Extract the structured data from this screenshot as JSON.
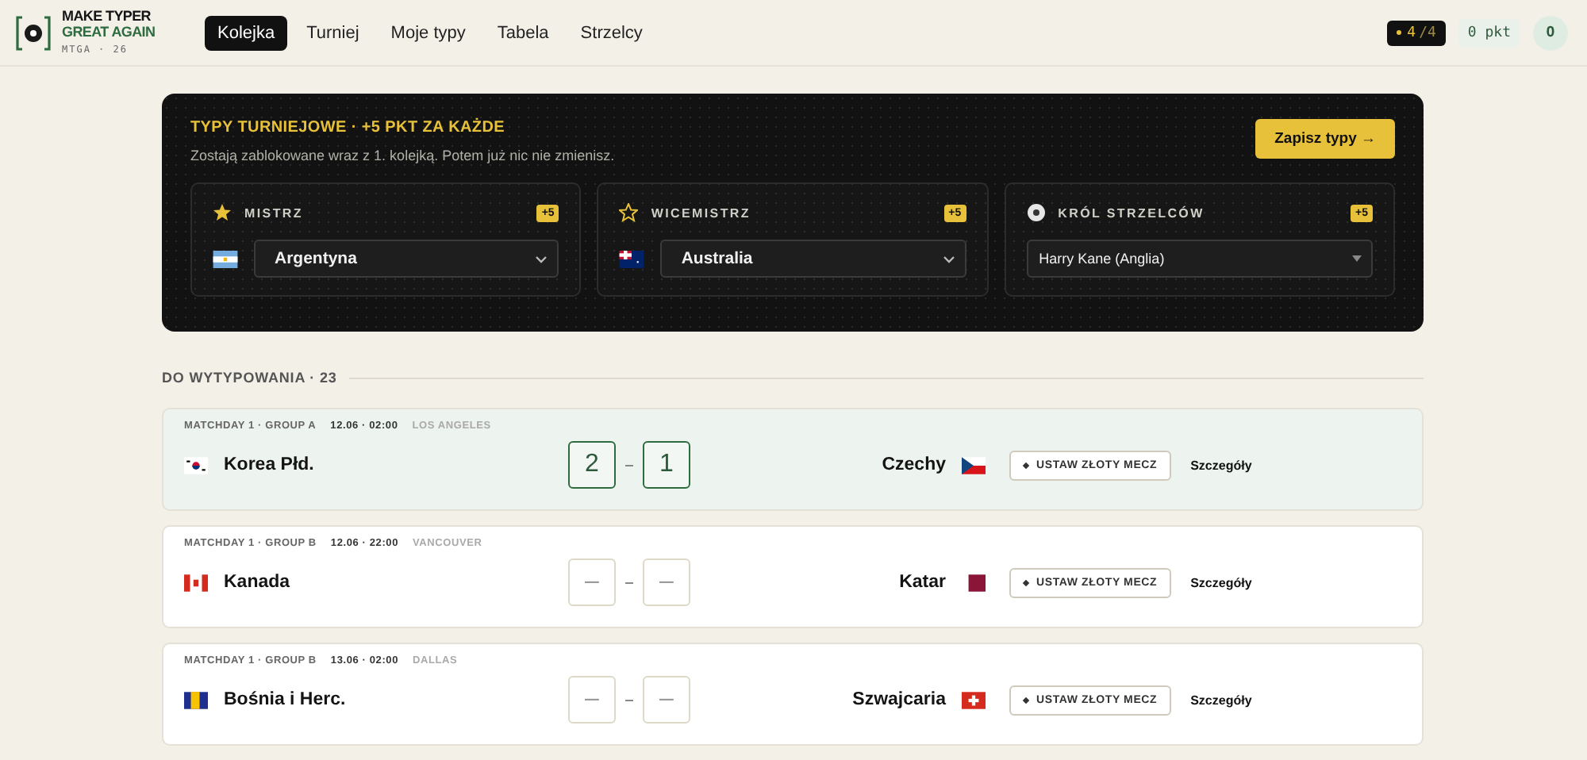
{
  "logo": {
    "line1": "MAKE TYPER",
    "line2": "GREAT AGAIN",
    "sub": "MTGA · 26"
  },
  "nav": [
    {
      "label": "Kolejka",
      "selected": true
    },
    {
      "label": "Turniej",
      "selected": false
    },
    {
      "label": "Moje typy",
      "selected": false
    },
    {
      "label": "Tabela",
      "selected": false
    },
    {
      "label": "Strzelcy",
      "selected": false
    }
  ],
  "status": {
    "done": "4",
    "total": "/4",
    "points": "0 pkt",
    "avatar": "O"
  },
  "tournament": {
    "title": "TYPY TURNIEJOWE · +5 PKT ZA KAŻDE",
    "subtitle": "Zostają zablokowane wraz z 1. kolejką. Potem już nic nie zmienisz.",
    "save": "Zapisz typy →",
    "picks": [
      {
        "label": "MISTRZ",
        "bonus": "+5",
        "value": "Argentyna"
      },
      {
        "label": "WICEMISTRZ",
        "bonus": "+5",
        "value": "Australia"
      },
      {
        "label": "KRÓL STRZELCÓW",
        "bonus": "+5",
        "value": "Harry Kane (Anglia)"
      }
    ]
  },
  "section": {
    "title": "DO WYTYPOWANIA · 23"
  },
  "matches": [
    {
      "round": "MATCHDAY 1 · GROUP A",
      "time": "12.06 · 02:00",
      "city": "LOS ANGELES",
      "home": "Korea Płd.",
      "away": "Czechy",
      "home_score": "2",
      "away_score": "1",
      "highlighted": true,
      "golden": "USTAW ZŁOTY MECZ",
      "details": "Szczegóły"
    },
    {
      "round": "MATCHDAY 1 · GROUP B",
      "time": "12.06 · 22:00",
      "city": "VANCOUVER",
      "home": "Kanada",
      "away": "Katar",
      "home_placeholder": "–",
      "away_placeholder": "–",
      "highlighted": false,
      "golden": "USTAW ZŁOTY MECZ",
      "details": "Szczegóły"
    },
    {
      "round": "MATCHDAY 1 · GROUP B",
      "time": "13.06 · 02:00",
      "city": "DALLAS",
      "home": "Bośnia i Herc.",
      "away": "Szwajcaria",
      "home_placeholder": "–",
      "away_placeholder": "–",
      "highlighted": false,
      "golden": "USTAW ZŁOTY MECZ",
      "details": "Szczegóły"
    }
  ]
}
